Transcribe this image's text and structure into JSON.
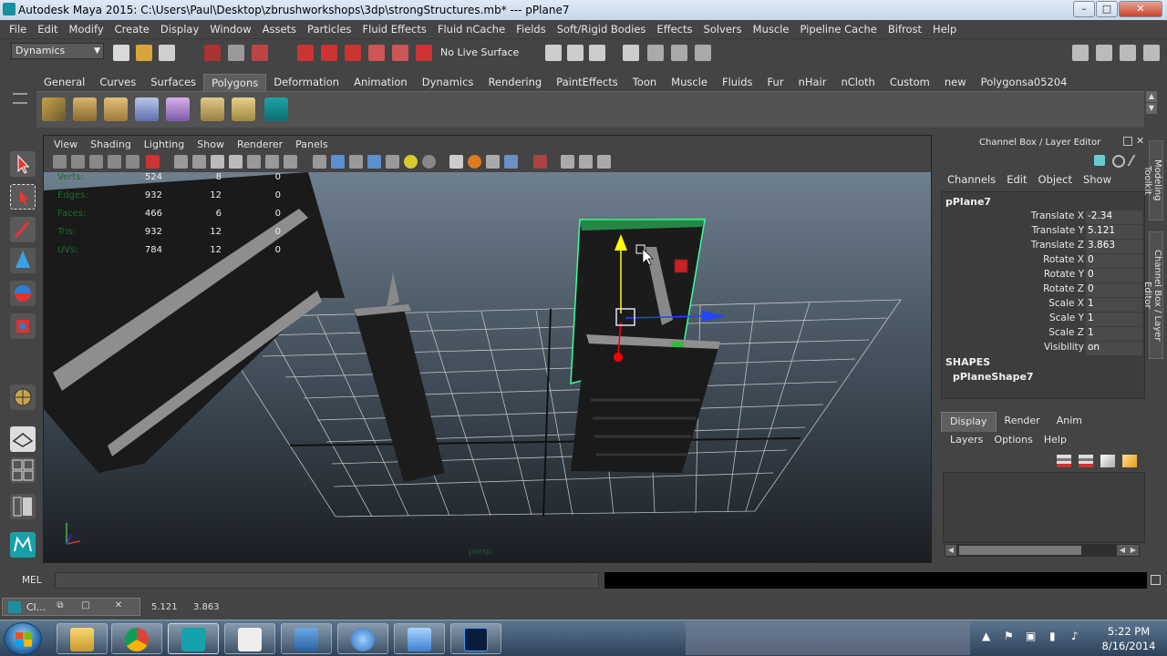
{
  "window": {
    "title": "Autodesk Maya 2015: C:\\Users\\Paul\\Desktop\\zbrushworkshops\\3dp\\strongStructures.mb*   ---   pPlane7",
    "minimize": "–",
    "maximize": "□",
    "close": "✕"
  },
  "menubar": [
    "File",
    "Edit",
    "Modify",
    "Create",
    "Display",
    "Window",
    "Assets",
    "Particles",
    "Fluid Effects",
    "Fluid nCache",
    "Fields",
    "Soft/Rigid Bodies",
    "Effects",
    "Solvers",
    "Muscle",
    "Pipeline Cache",
    "Bifrost",
    "Help"
  ],
  "statusline": {
    "mode": "Dynamics",
    "live_surface": "No Live Surface"
  },
  "shelf": {
    "tabs": [
      "General",
      "Curves",
      "Surfaces",
      "Polygons",
      "Deformation",
      "Animation",
      "Dynamics",
      "Rendering",
      "PaintEffects",
      "Toon",
      "Muscle",
      "Fluids",
      "Fur",
      "nHair",
      "nCloth",
      "Custom",
      "new",
      "Polygonsa05204"
    ],
    "active_tab": "Polygons"
  },
  "viewport": {
    "menu": [
      "View",
      "Shading",
      "Lighting",
      "Show",
      "Renderer",
      "Panels"
    ],
    "hud": [
      {
        "label": "Verts:",
        "c1": "524",
        "c2": "8",
        "c3": "0"
      },
      {
        "label": "Edges:",
        "c1": "932",
        "c2": "12",
        "c3": "0"
      },
      {
        "label": "Faces:",
        "c1": "466",
        "c2": "6",
        "c3": "0"
      },
      {
        "label": "Tris:",
        "c1": "932",
        "c2": "12",
        "c3": "0"
      },
      {
        "label": "UVs:",
        "c1": "784",
        "c2": "12",
        "c3": "0"
      }
    ],
    "camera_label": "persp"
  },
  "channel_box": {
    "header": "Channel Box / Layer Editor",
    "menu": [
      "Channels",
      "Edit",
      "Object",
      "Show"
    ],
    "object": "pPlane7",
    "attributes": [
      {
        "name": "Translate X",
        "value": "-2.34"
      },
      {
        "name": "Translate Y",
        "value": "5.121"
      },
      {
        "name": "Translate Z",
        "value": "3.863"
      },
      {
        "name": "Rotate X",
        "value": "0"
      },
      {
        "name": "Rotate Y",
        "value": "0"
      },
      {
        "name": "Rotate Z",
        "value": "0"
      },
      {
        "name": "Scale X",
        "value": "1"
      },
      {
        "name": "Scale Y",
        "value": "1"
      },
      {
        "name": "Scale Z",
        "value": "1"
      },
      {
        "name": "Visibility",
        "value": "on"
      }
    ],
    "shapes_label": "SHAPES",
    "shape_name": "pPlaneShape7"
  },
  "side_tabs": [
    "Modeling Toolkit",
    "Channel Box / Layer Editor"
  ],
  "layer_editor": {
    "tabs": [
      "Display",
      "Render",
      "Anim"
    ],
    "active_tab": "Display",
    "menu": [
      "Layers",
      "Options",
      "Help"
    ]
  },
  "command_line": {
    "label": "MEL"
  },
  "help_line": {
    "minimized_title": "Cl...",
    "value_a": "5.121",
    "value_b": "3.863"
  },
  "taskbar": {
    "time": "5:22 PM",
    "date": "8/16/2014"
  },
  "colors": {
    "ui_bg": "#444444",
    "selection_wire": "#3dff9a",
    "manip_y": "#ffff00",
    "manip_x": "#ff0000",
    "manip_z": "#2244ff"
  }
}
